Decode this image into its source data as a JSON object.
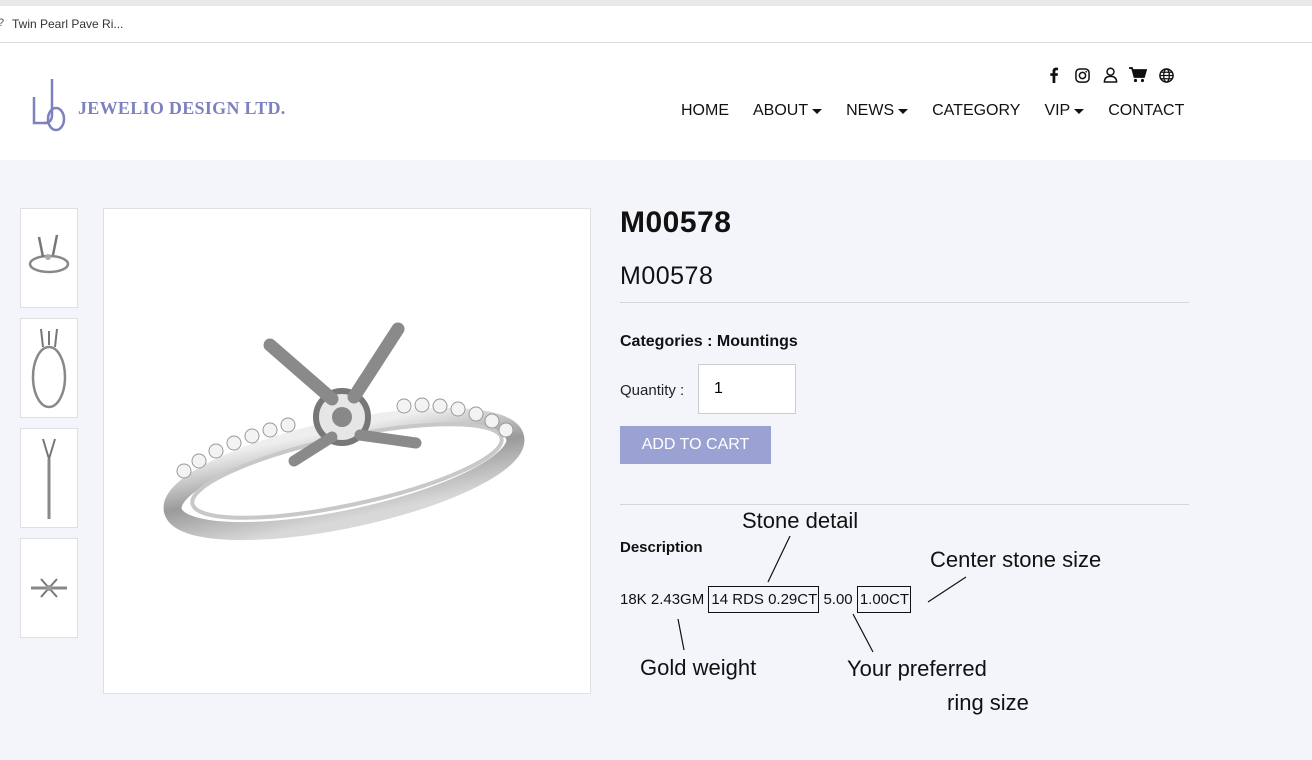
{
  "browser": {
    "tab_title": "Twin Pearl Pave Ri..."
  },
  "brand": {
    "logo_letters": "JLO",
    "name": "JEWELIO DESIGN LTD."
  },
  "social_icons": [
    "facebook-icon",
    "instagram-icon",
    "user-icon",
    "cart-icon",
    "globe-icon"
  ],
  "nav": [
    {
      "label": "HOME",
      "dropdown": false
    },
    {
      "label": "ABOUT",
      "dropdown": true
    },
    {
      "label": "NEWS",
      "dropdown": true
    },
    {
      "label": "CATEGORY",
      "dropdown": false
    },
    {
      "label": "VIP",
      "dropdown": true
    },
    {
      "label": "CONTACT",
      "dropdown": false
    }
  ],
  "product": {
    "title": "M00578",
    "subtitle": "M00578",
    "categories_label": "Categories : ",
    "category": "Mountings",
    "quantity_label": "Quantity : ",
    "quantity_value": "1",
    "add_to_cart": "ADD TO CART",
    "description_label": "Description",
    "description": {
      "gold": "18K 2.43GM",
      "stone_detail": "14 RDS 0.29CT",
      "ring_size": "5.00",
      "center_stone": "1.00CT"
    }
  },
  "annotations": {
    "stone_detail": "Stone detail",
    "center_stone_size": "Center stone size",
    "gold_weight": "Gold weight",
    "preferred_ring_size_line1": "Your preferred",
    "preferred_ring_size_line2": "ring size"
  },
  "colors": {
    "accent": "#9aa2d4",
    "logo": "#7d82bf",
    "background": "#f4f5fa"
  }
}
